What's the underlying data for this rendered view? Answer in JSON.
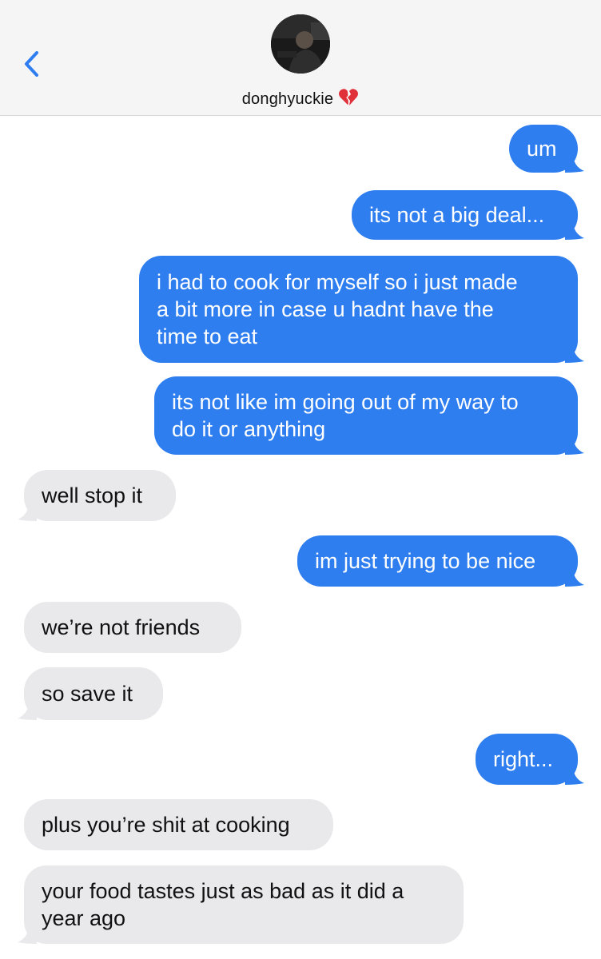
{
  "header": {
    "back_icon": "chevron-left-icon",
    "contact_name": "donghyuckie",
    "contact_emoji": "broken-heart-icon",
    "accent_color": "#2f7ef0"
  },
  "messages": [
    {
      "direction": "sent",
      "text": "um"
    },
    {
      "direction": "sent",
      "text": "its not a big deal..."
    },
    {
      "direction": "sent",
      "text": "i had to cook for myself so i just made\na bit more in case u hadnt have the\ntime to eat"
    },
    {
      "direction": "sent",
      "text": "its not like im going out of my way to\ndo it or anything"
    },
    {
      "direction": "received",
      "text": "well stop it"
    },
    {
      "direction": "sent",
      "text": "im just trying to be nice"
    },
    {
      "direction": "received",
      "text": "we’re not friends"
    },
    {
      "direction": "received",
      "text": "so save it"
    },
    {
      "direction": "sent",
      "text": "right..."
    },
    {
      "direction": "received",
      "text": "plus you’re shit at cooking"
    },
    {
      "direction": "received",
      "text": "your food tastes just as bad as it did a\nyear ago"
    }
  ],
  "colors": {
    "sent_bubble": "#2f7ef0",
    "received_bubble": "#e9e9eb",
    "header_bg": "#f5f5f6"
  }
}
